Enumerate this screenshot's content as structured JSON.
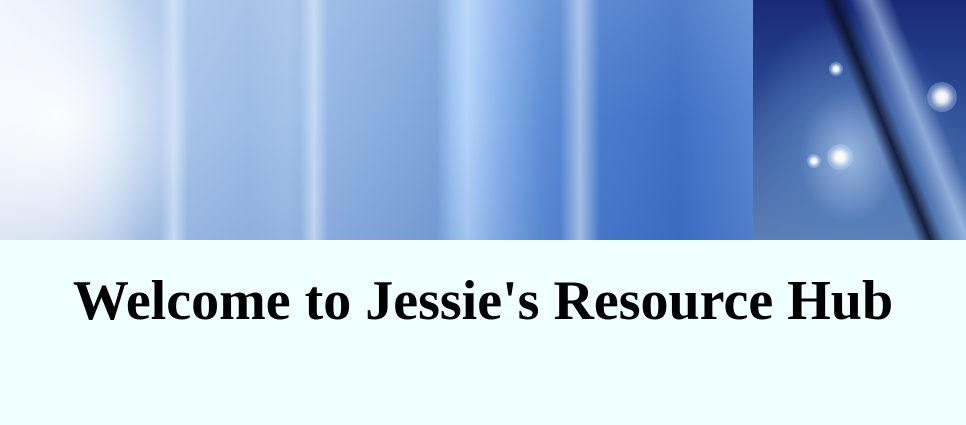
{
  "page": {
    "background_color": "#f0ffff"
  },
  "banner": {
    "left_image": "blurred-blue-abstract",
    "right_image": "dark-blue-sparkle-abstract",
    "accent_colors": [
      "#eef4fd",
      "#9dbce6",
      "#3f70c4",
      "#1a2a78"
    ]
  },
  "main": {
    "heading": "Welcome to Jessie's Resource Hub"
  }
}
